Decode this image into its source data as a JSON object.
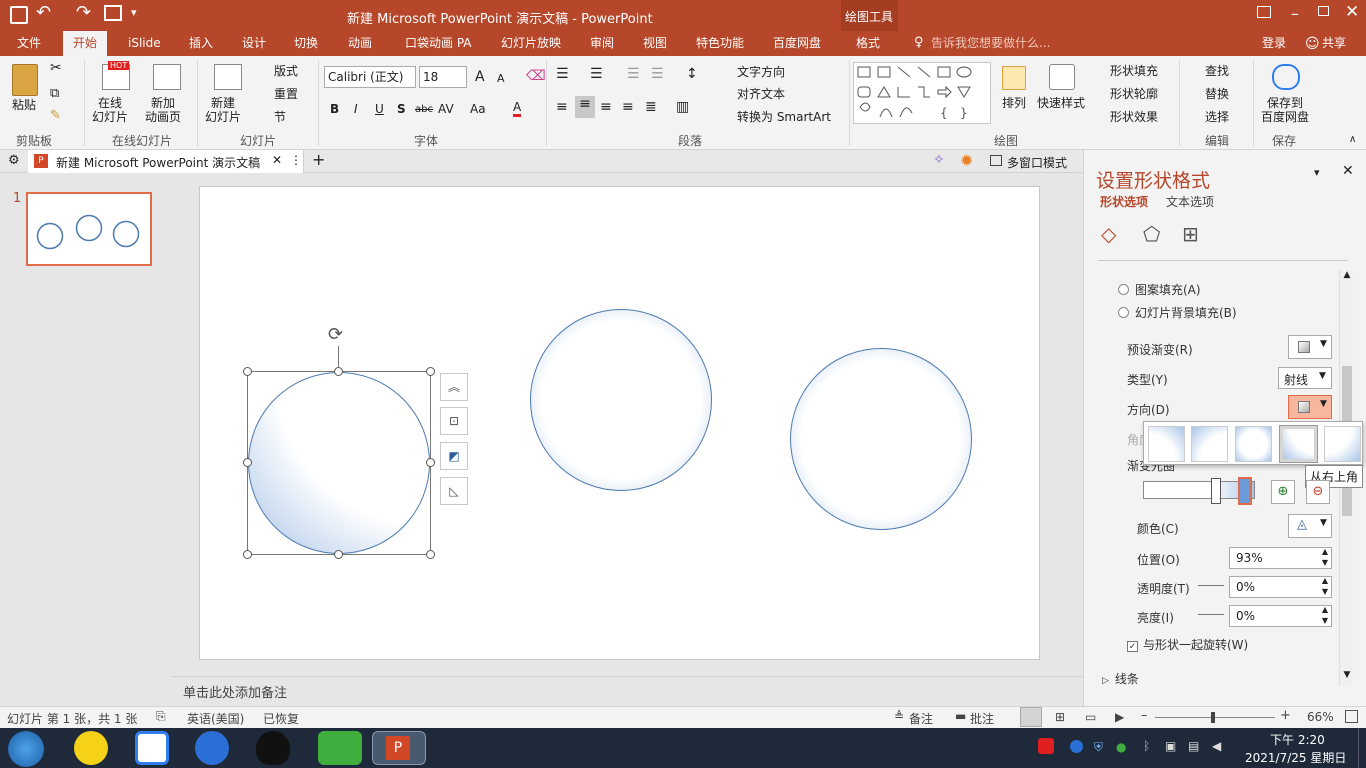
{
  "titlebar": {
    "title": "新建 Microsoft PowerPoint 演示文稿 - PowerPoint",
    "context_group": "绘图工具"
  },
  "tabs": [
    "文件",
    "开始",
    "iSlide",
    "插入",
    "设计",
    "切换",
    "动画",
    "口袋动画 PA",
    "幻灯片放映",
    "审阅",
    "视图",
    "特色功能",
    "百度网盘",
    "格式"
  ],
  "tell_me": "告诉我您想要做什么...",
  "login": "登录",
  "share": "共享",
  "ribbon": {
    "clipboard": {
      "paste": "粘贴",
      "label": "剪贴板"
    },
    "online": {
      "online_slide": "在线\n幻灯片",
      "new_anim": "新加\n动画页",
      "label": "在线幻灯片",
      "hot": "HOT"
    },
    "slides": {
      "new_slide": "新建\n幻灯片",
      "layout": "版式",
      "reset": "重置",
      "section": "节",
      "label": "幻灯片"
    },
    "font": {
      "name": "Calibri (正文)",
      "size": "18",
      "bold": "B",
      "italic": "I",
      "underline": "U",
      "shadow": "S",
      "strike": "abc",
      "spacing": "AV",
      "case": "Aa",
      "color": "A",
      "grow": "A",
      "shrink": "A",
      "label": "字体"
    },
    "paragraph": {
      "text_dir": "文字方向",
      "align_text": "对齐文本",
      "smartart": "转换为 SmartArt",
      "label": "段落"
    },
    "drawing": {
      "arrange": "排列",
      "quick_styles": "快速样式",
      "fill": "形状填充",
      "outline": "形状轮廓",
      "effects": "形状效果",
      "label": "绘图"
    },
    "editing": {
      "find": "查找",
      "replace": "替换",
      "select": "选择",
      "label": "编辑"
    },
    "save": {
      "baidu": "保存到\n百度网盘",
      "label": "保存"
    }
  },
  "doctab": {
    "name": "新建 Microsoft PowerPoint 演示文稿",
    "multiwindow": "多窗口模式"
  },
  "thumbnail": {
    "number": "1"
  },
  "notes_placeholder": "单击此处添加备注",
  "format_pane": {
    "title": "设置形状格式",
    "tab_shape": "形状选项",
    "tab_text": "文本选项",
    "opt_pattern": "图案填充(A)",
    "opt_bg": "幻灯片背景填充(B)",
    "preset": "预设渐变(R)",
    "type_label": "类型(Y)",
    "type_value": "射线",
    "direction": "方向(D)",
    "angle": "角度",
    "stops": "渐变光圈",
    "tooltip": "从右上角",
    "color": "颜色(C)",
    "position_label": "位置(O)",
    "position_value": "93%",
    "transparency_label": "透明度(T)",
    "transparency_value": "0%",
    "brightness_label": "亮度(I)",
    "brightness_value": "0%",
    "rotate_label": "与形状一起旋转(W)",
    "line_section": "线条"
  },
  "statusbar": {
    "slide_info": "幻灯片 第 1 张，共 1 张",
    "language": "英语(美国)",
    "recovered": "已恢复",
    "notes": "备注",
    "comments": "批注",
    "zoom": "66%"
  },
  "taskbar": {
    "time": "下午 2:20",
    "date": "2021/7/25 星期日"
  },
  "colors": {
    "accent": "#b7472a",
    "circle_edge": "#4e7ab0"
  }
}
